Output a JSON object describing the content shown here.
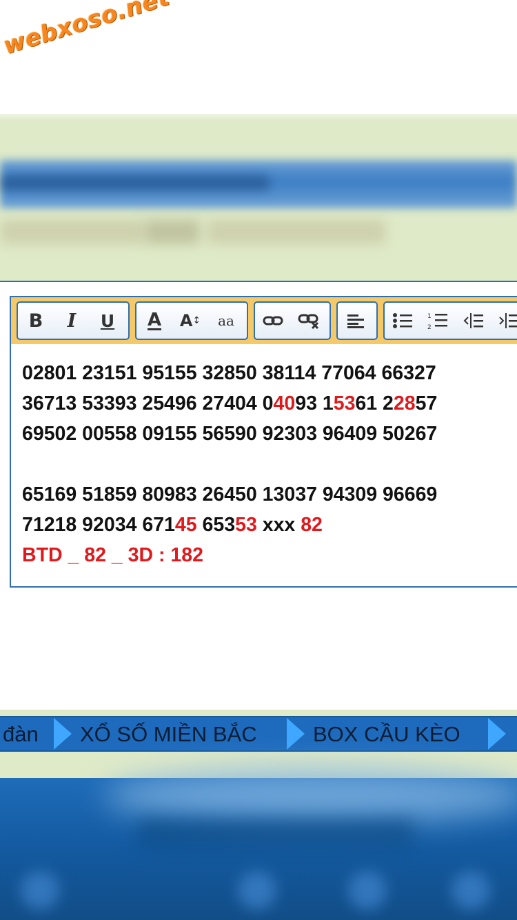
{
  "site": {
    "logo_text": "webxoso.net"
  },
  "toolbar": {
    "groups": [
      {
        "name": "format",
        "buttons": [
          "bold-icon",
          "italic-icon",
          "underline-icon"
        ]
      },
      {
        "name": "font",
        "buttons": [
          "font-color-icon",
          "font-size-icon",
          "font-family-icon"
        ]
      },
      {
        "name": "link",
        "buttons": [
          "link-icon",
          "unlink-icon"
        ]
      },
      {
        "name": "align",
        "buttons": [
          "align-left-icon"
        ]
      },
      {
        "name": "list",
        "buttons": [
          "bulleted-list-icon",
          "numbered-list-icon",
          "outdent-icon",
          "indent-icon"
        ]
      }
    ],
    "labels": {
      "bold": "B",
      "italic": "I",
      "underline": "U",
      "font_color": "A",
      "font_size": "A",
      "font_family": "aa"
    }
  },
  "editor": {
    "line1": "02801 23151 95155 32850 38114 77064 66327",
    "line2": {
      "p1": "36713 53393 25496 27404 0",
      "r1": "40",
      "p2": "93 1",
      "r2": "53",
      "p3": "61 2",
      "r3": "28",
      "p4": "57"
    },
    "line3": "69502 00558 09155 56590 92303 96409 50267",
    "line4": "65169 51859 80983 26450 13037 94309 96669",
    "line5": {
      "p1": "71218 92034 671",
      "r1": "45",
      "p2": " 653",
      "r2": "53",
      "p3": " xxx ",
      "r3": "82"
    },
    "line6": "BTD _ 82 _ 3D : 182"
  },
  "nav": {
    "items": [
      "đàn",
      "XỔ SỐ MIỀN BẮC",
      "BOX CẦU KÈO"
    ]
  },
  "colors": {
    "accent_blue": "#2f6fb0",
    "toolbar_bg": "#f6c968",
    "highlight_red": "#e0191c",
    "page_bg": "#dfeac8"
  }
}
